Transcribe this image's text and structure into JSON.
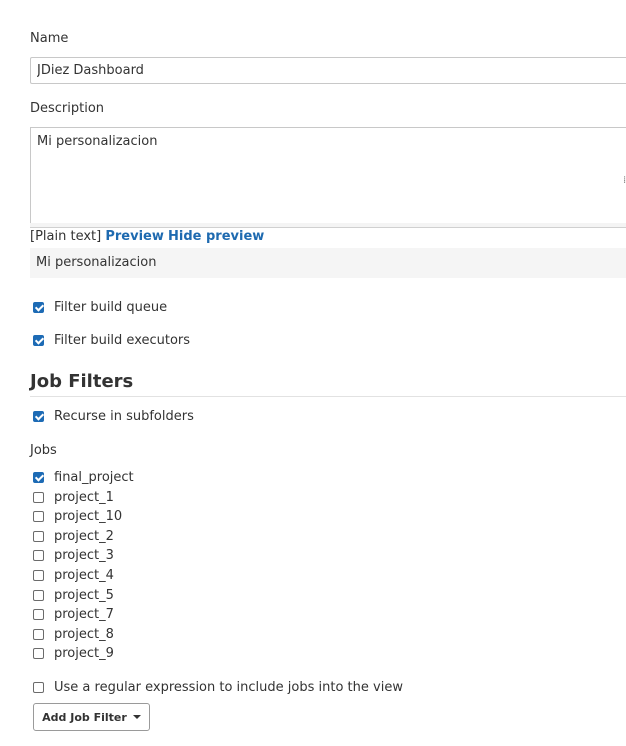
{
  "form": {
    "name_label": "Name",
    "name_value": "JDiez Dashboard",
    "description_label": "Description",
    "description_value": "Mi personalizacion",
    "markup_format": "[Plain text]",
    "preview_link": "Preview",
    "hide_preview_link": "Hide preview",
    "preview_text": "Mi personalizacion",
    "filter_build_queue": {
      "label": "Filter build queue",
      "checked": true
    },
    "filter_build_executors": {
      "label": "Filter build executors",
      "checked": true
    }
  },
  "job_filters": {
    "title": "Job Filters",
    "recurse": {
      "label": "Recurse in subfolders",
      "checked": true
    },
    "jobs_label": "Jobs",
    "jobs": [
      {
        "label": "final_project",
        "checked": true
      },
      {
        "label": "project_1",
        "checked": false
      },
      {
        "label": "project_10",
        "checked": false
      },
      {
        "label": "project_2",
        "checked": false
      },
      {
        "label": "project_3",
        "checked": false
      },
      {
        "label": "project_4",
        "checked": false
      },
      {
        "label": "project_5",
        "checked": false
      },
      {
        "label": "project_7",
        "checked": false
      },
      {
        "label": "project_8",
        "checked": false
      },
      {
        "label": "project_9",
        "checked": false
      }
    ],
    "regex": {
      "label": "Use a regular expression to include jobs into the view",
      "checked": false
    },
    "add_button_label": "Add Job Filter",
    "add_button_icon": "caret-down-icon"
  },
  "colors": {
    "accent": "#1d6bb5",
    "link": "#1e6ab0",
    "text": "#333333"
  }
}
